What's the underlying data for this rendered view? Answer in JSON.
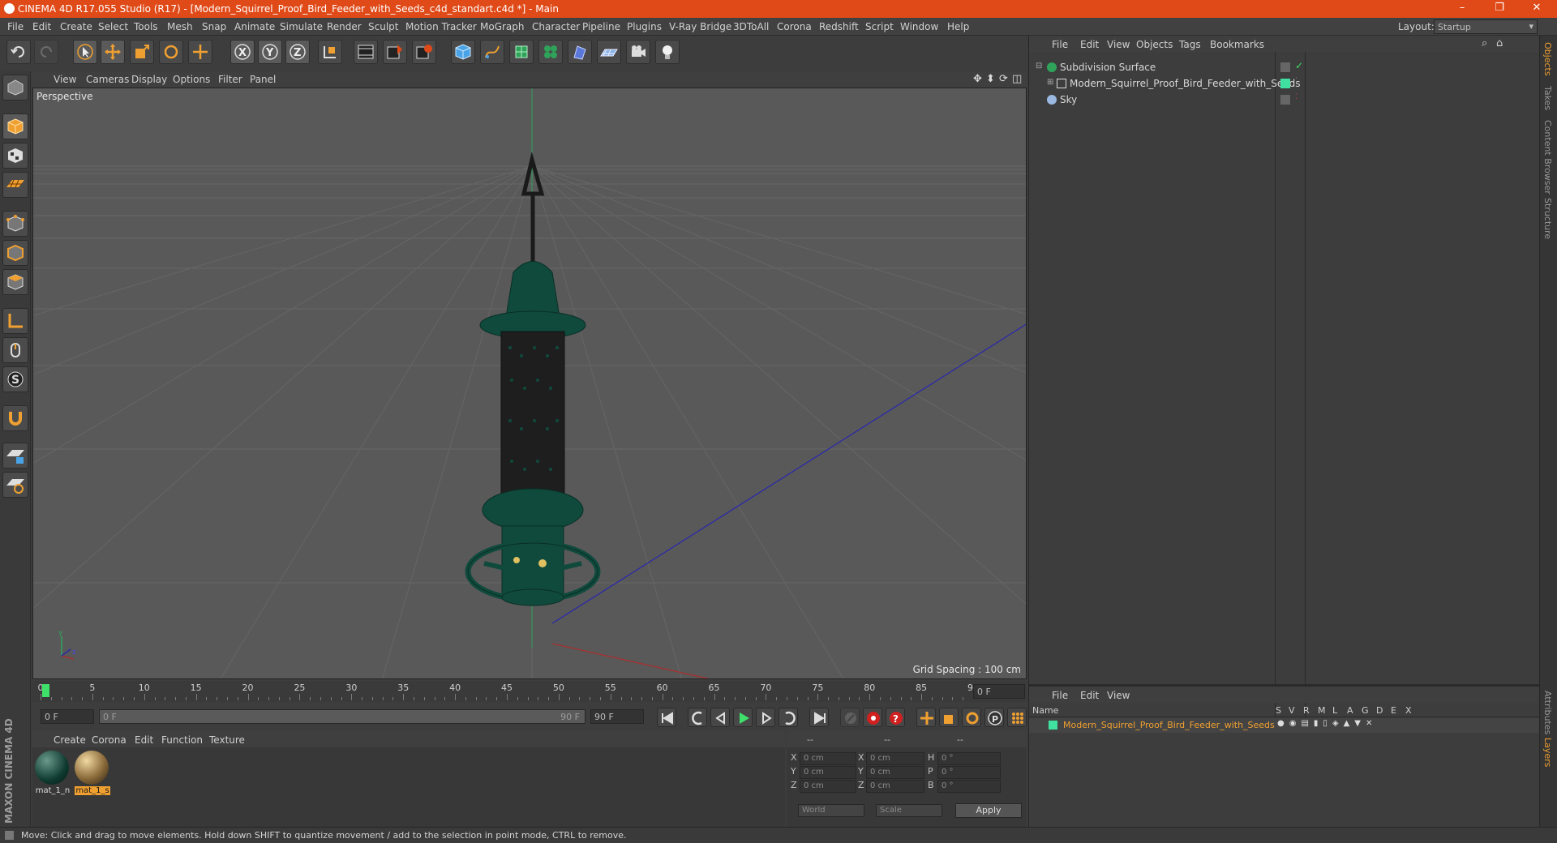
{
  "window": {
    "title": "CINEMA 4D R17.055 Studio (R17) - [Modern_Squirrel_Proof_Bird_Feeder_with_Seeds_c4d_standart.c4d *] - Main",
    "minimize": "–",
    "restore": "❐",
    "close": "✕"
  },
  "menu": [
    "File",
    "Edit",
    "Create",
    "Select",
    "Tools",
    "Mesh",
    "Snap",
    "Animate",
    "Simulate",
    "Render",
    "Sculpt",
    "Motion Tracker",
    "MoGraph",
    "Character",
    "Pipeline",
    "Plugins",
    "V-Ray Bridge",
    "3DToAll",
    "Corona",
    "Redshift",
    "Script",
    "Window",
    "Help"
  ],
  "layout": {
    "label": "Layout:",
    "value": "Startup"
  },
  "viewport": {
    "menu": [
      "View",
      "Cameras",
      "Display",
      "Options",
      "Filter",
      "Panel"
    ],
    "label": "Perspective",
    "grid_spacing": "Grid Spacing : 100 cm"
  },
  "timeline": {
    "ticks": [
      "0",
      "5",
      "10",
      "15",
      "20",
      "25",
      "30",
      "35",
      "40",
      "45",
      "50",
      "55",
      "60",
      "65",
      "70",
      "75",
      "80",
      "85",
      "90"
    ],
    "current_frame": "0 F",
    "start_field": "0 F",
    "range_start": "0 F",
    "range_end": "90 F",
    "end_field": "90 F"
  },
  "material_panel": {
    "menu": [
      "Create",
      "Corona",
      "Edit",
      "Function",
      "Texture"
    ],
    "materials": [
      {
        "label": "mat_1_n",
        "selected": false
      },
      {
        "label": "mat_1_s",
        "selected": true
      }
    ]
  },
  "coords": {
    "headers": [
      "--",
      "--",
      "--"
    ],
    "rows": [
      {
        "a": "X",
        "av": "0 cm",
        "b": "X",
        "bv": "0 cm",
        "c": "H",
        "cv": "0 °"
      },
      {
        "a": "Y",
        "av": "0 cm",
        "b": "Y",
        "bv": "0 cm",
        "c": "P",
        "cv": "0 °"
      },
      {
        "a": "Z",
        "av": "0 cm",
        "b": "Z",
        "bv": "0 cm",
        "c": "B",
        "cv": "0 °"
      }
    ],
    "mode1": "World",
    "mode2": "Scale",
    "apply": "Apply"
  },
  "object_manager": {
    "menu": [
      "File",
      "Edit",
      "View",
      "Objects",
      "Tags",
      "Bookmarks"
    ],
    "objects": [
      {
        "name": "Subdivision Surface"
      },
      {
        "name": "Modern_Squirrel_Proof_Bird_Feeder_with_Seeds"
      },
      {
        "name": "Sky"
      }
    ]
  },
  "layer_manager": {
    "menu": [
      "File",
      "Edit",
      "View"
    ],
    "columns": [
      "Name",
      "S",
      "V",
      "R",
      "M",
      "L",
      "A",
      "G",
      "D",
      "E",
      "X"
    ],
    "row": "Modern_Squirrel_Proof_Bird_Feeder_with_Seeds"
  },
  "side_tabs_top": [
    "Objects",
    "Takes",
    "Content Browser",
    "Structure"
  ],
  "side_tabs_bottom": [
    "Attributes",
    "Layers"
  ],
  "maxon_logo": "MAXON CINEMA 4D",
  "status": "Move: Click and drag to move elements. Hold down SHIFT to quantize movement / add to the selection in point mode, CTRL to remove.",
  "colors": {
    "title_bar": "#e04a18",
    "accent": "#f0a030",
    "feeder": "#0f4a3c",
    "object_green": "#3fe0a0"
  }
}
